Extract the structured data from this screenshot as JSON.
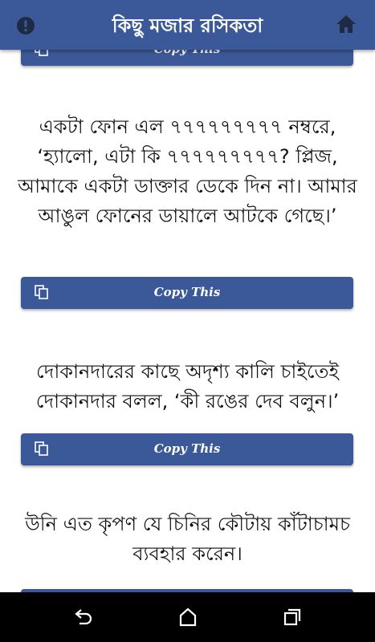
{
  "app": {
    "title": "কিছু মজার রসিকতা"
  },
  "copy_label": "Copy This",
  "jokes": [
    {
      "text": "একটা ফোন এল ৭৭৭৭৭৭৭৭৭ নম্বরে, ‘হ্যালো, এটা কি ৭৭৭৭৭৭৭৭৭? প্লিজ, আমাকে একটা ডাক্তার ডেকে দিন না। আমার আঙুল ফোনের ডায়ালে আটকে গেছে।’"
    },
    {
      "text": "দোকানদারের কাছে অদৃশ্য কালি চাইতেই দোকানদার বলল, ‘কী রঙের দেব বলুন।’"
    },
    {
      "text": "উনি এত কৃপণ যে চিনির কৌটায় কাঁটাচামচ ব্যবহার করেন।"
    }
  ],
  "colors": {
    "primary": "#3b5998",
    "navbar": "#000000"
  },
  "icons": {
    "appbar_left": "info-icon",
    "appbar_right": "home-icon",
    "copy": "copy-icon",
    "nav": [
      "back-icon",
      "home-icon",
      "recents-icon"
    ]
  }
}
